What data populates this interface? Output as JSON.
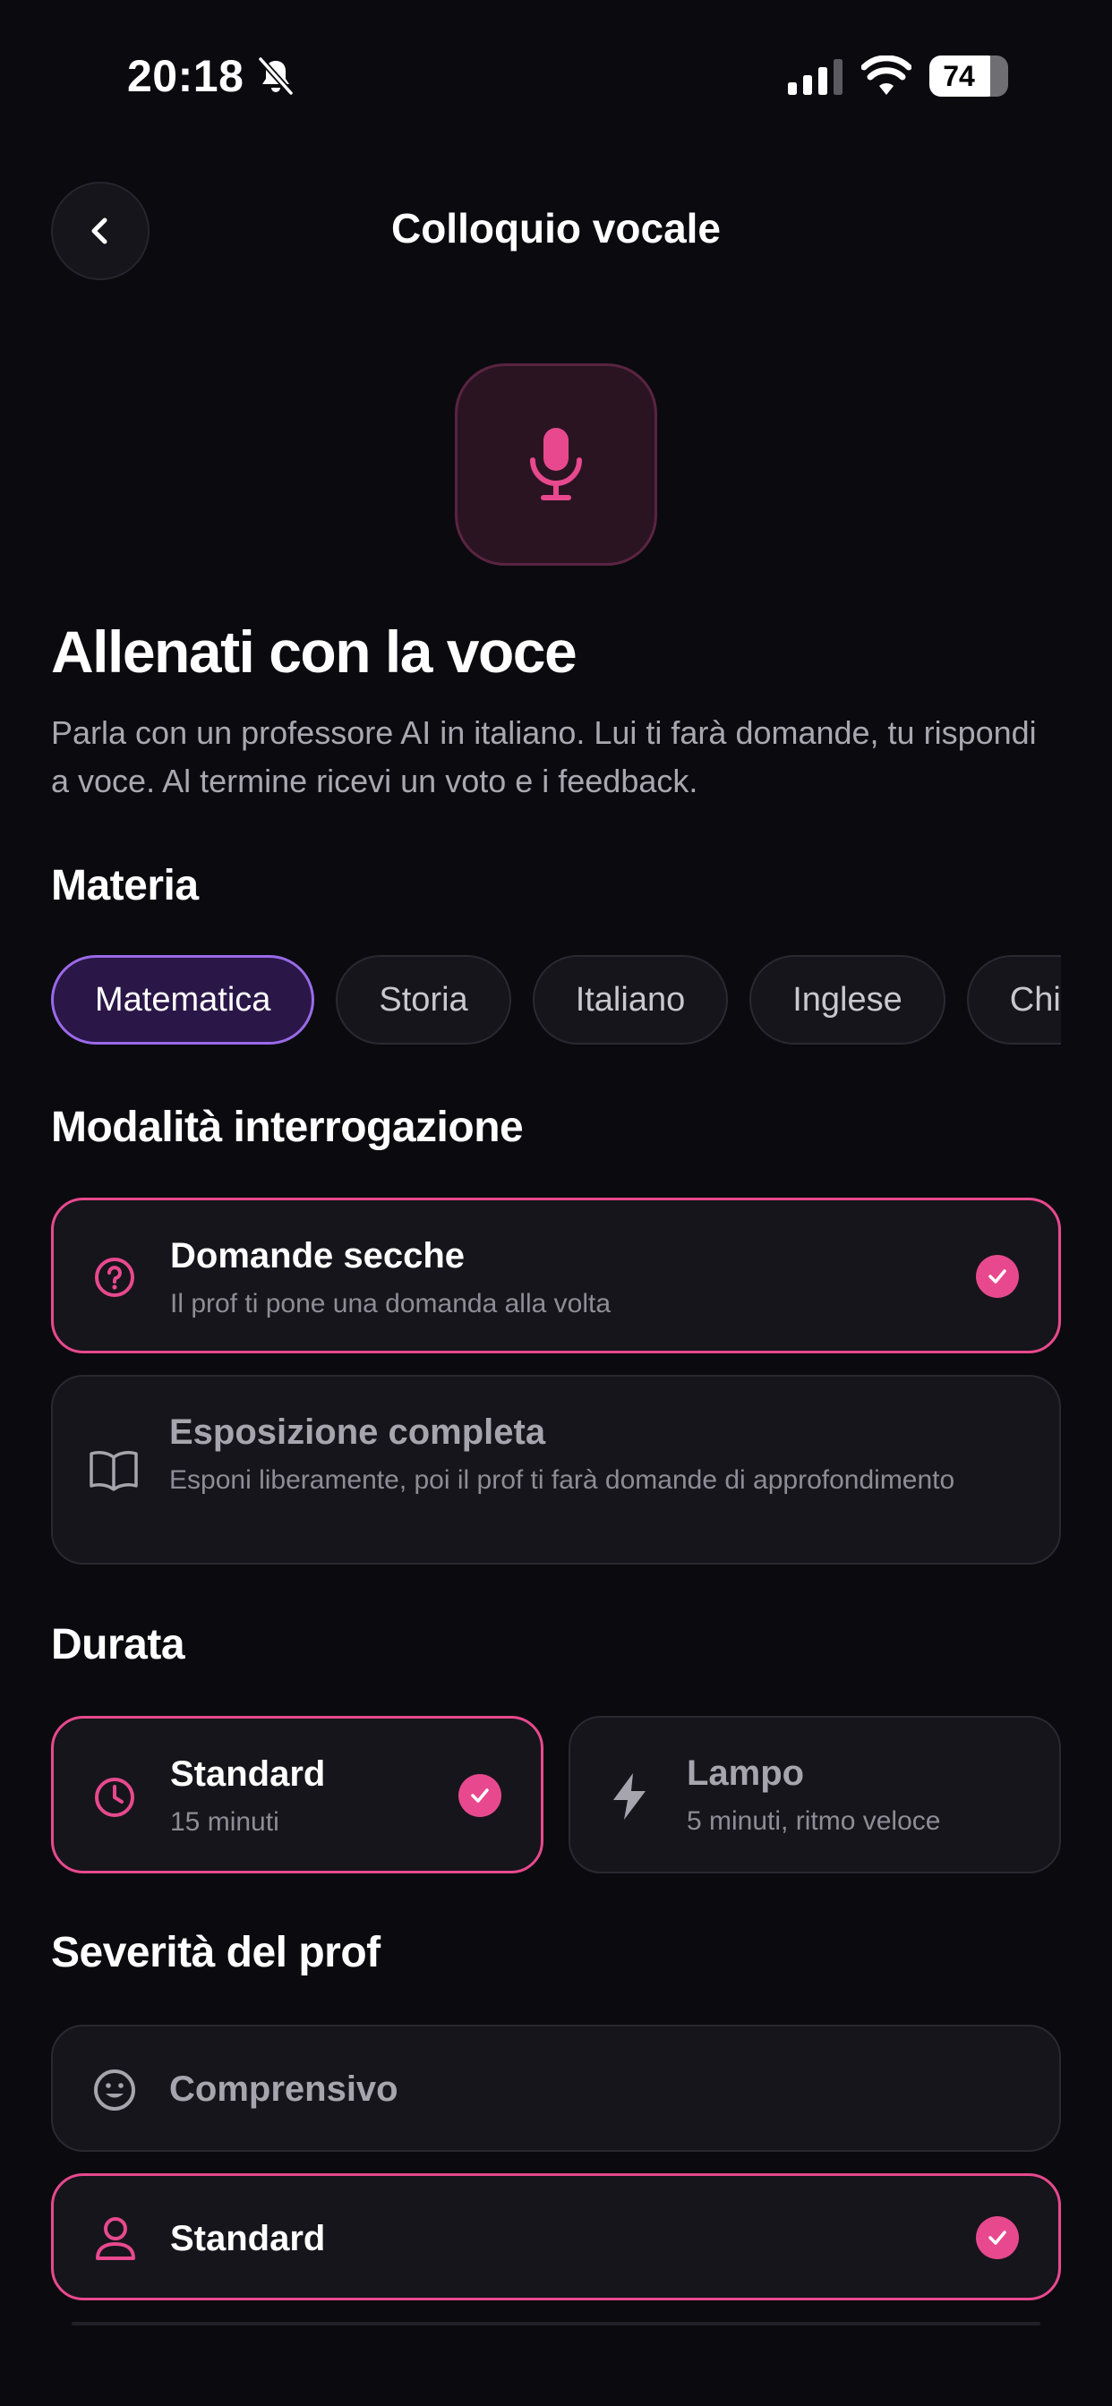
{
  "status_bar": {
    "time": "20:18",
    "battery": "74"
  },
  "header": {
    "title": "Colloquio vocale"
  },
  "hero": {
    "title": "Allenati con la voce",
    "description": "Parla con un professore AI in italiano. Lui ti farà domande, tu rispondi a voce. Al termine ricevi un voto e i feedback."
  },
  "materia": {
    "label": "Materia",
    "options": [
      "Matematica",
      "Storia",
      "Italiano",
      "Inglese",
      "Chimica"
    ],
    "selected": "Matematica"
  },
  "modalita": {
    "label": "Modalità interrogazione",
    "options": [
      {
        "title": "Domande secche",
        "subtitle": "Il prof ti pone una domanda alla volta",
        "icon": "question-circle-icon",
        "selected": true
      },
      {
        "title": "Esposizione completa",
        "subtitle": "Esponi liberamente, poi il prof ti farà domande di approfondimento",
        "icon": "open-book-icon",
        "selected": false
      }
    ]
  },
  "durata": {
    "label": "Durata",
    "options": [
      {
        "title": "Standard",
        "subtitle": "15 minuti",
        "icon": "clock-icon",
        "selected": true
      },
      {
        "title": "Lampo",
        "subtitle": "5 minuti, ritmo veloce",
        "icon": "lightning-icon",
        "selected": false
      }
    ]
  },
  "severita": {
    "label": "Severità del prof",
    "options": [
      {
        "title": "Comprensivo",
        "icon": "smiley-face-icon",
        "selected": false
      },
      {
        "title": "Standard",
        "icon": "person-icon",
        "selected": true
      }
    ]
  },
  "colors": {
    "accent": "#e8498e",
    "chip_selected": "#9a6ae8",
    "background": "#0b0a0f",
    "card": "#16151b"
  }
}
